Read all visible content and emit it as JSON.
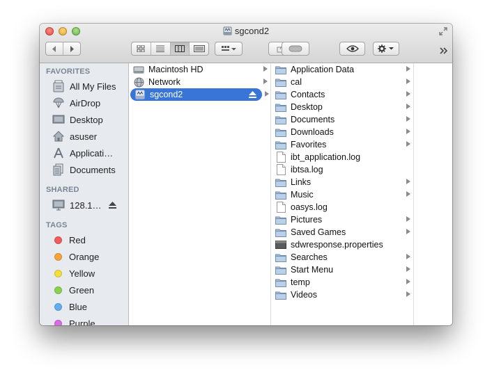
{
  "window": {
    "title": "sgcond2"
  },
  "toolbar": {
    "nav": [
      "back",
      "forward"
    ],
    "view_modes": [
      "icon-view",
      "list-view",
      "column-view",
      "cover-flow-view"
    ],
    "arrange_icon": "arrange-icon",
    "share_icon": "share-icon",
    "tag_icon": "tag-icon",
    "quicklook_icon": "eye-icon",
    "action_icon": "gear-icon"
  },
  "sidebar": {
    "favorites_header": "FAVORITES",
    "favorites": [
      {
        "label": "All My Files",
        "icon": "all-files-icon"
      },
      {
        "label": "AirDrop",
        "icon": "airdrop-icon"
      },
      {
        "label": "Desktop",
        "icon": "desktop-icon"
      },
      {
        "label": "asuser",
        "icon": "home-icon"
      },
      {
        "label": "Applicati…",
        "icon": "applications-icon"
      },
      {
        "label": "Documents",
        "icon": "documents-icon"
      }
    ],
    "shared_header": "SHARED",
    "shared": [
      {
        "label": "128.1…",
        "icon": "monitor-icon"
      }
    ],
    "tags_header": "TAGS",
    "tags": [
      {
        "label": "Red",
        "color": "#f15b5b"
      },
      {
        "label": "Orange",
        "color": "#f6a43a"
      },
      {
        "label": "Yellow",
        "color": "#f5dd3c"
      },
      {
        "label": "Green",
        "color": "#8ad14f"
      },
      {
        "label": "Blue",
        "color": "#62aef0"
      },
      {
        "label": "Purple",
        "color": "#d96ce5"
      }
    ]
  },
  "columns": {
    "col1": [
      {
        "label": "Macintosh HD",
        "icon": "hard-drive-icon",
        "arrow": true
      },
      {
        "label": "Network",
        "icon": "network-icon",
        "arrow": true
      },
      {
        "label": "sgcond2",
        "icon": "server-disk-icon",
        "arrow": true,
        "selected": true,
        "eject": true
      }
    ],
    "col2": [
      {
        "label": "Application Data",
        "type": "folder",
        "arrow": true
      },
      {
        "label": "cal",
        "type": "folder",
        "arrow": true
      },
      {
        "label": "Contacts",
        "type": "folder",
        "arrow": true
      },
      {
        "label": "Desktop",
        "type": "folder",
        "arrow": true
      },
      {
        "label": "Documents",
        "type": "folder",
        "arrow": true
      },
      {
        "label": "Downloads",
        "type": "folder",
        "arrow": true
      },
      {
        "label": "Favorites",
        "type": "folder",
        "arrow": true
      },
      {
        "label": "ibt_application.log",
        "type": "file",
        "arrow": false
      },
      {
        "label": "ibtsa.log",
        "type": "file",
        "arrow": false
      },
      {
        "label": "Links",
        "type": "folder",
        "arrow": true
      },
      {
        "label": "Music",
        "type": "folder",
        "arrow": true
      },
      {
        "label": "oasys.log",
        "type": "file",
        "arrow": false
      },
      {
        "label": "Pictures",
        "type": "folder",
        "arrow": true
      },
      {
        "label": "Saved Games",
        "type": "folder",
        "arrow": true
      },
      {
        "label": "sdwresponse.properties",
        "type": "properties",
        "arrow": false
      },
      {
        "label": "Searches",
        "type": "folder",
        "arrow": true
      },
      {
        "label": "Start Menu",
        "type": "folder",
        "arrow": true
      },
      {
        "label": "temp",
        "type": "folder",
        "arrow": true
      },
      {
        "label": "Videos",
        "type": "folder",
        "arrow": true
      }
    ]
  }
}
